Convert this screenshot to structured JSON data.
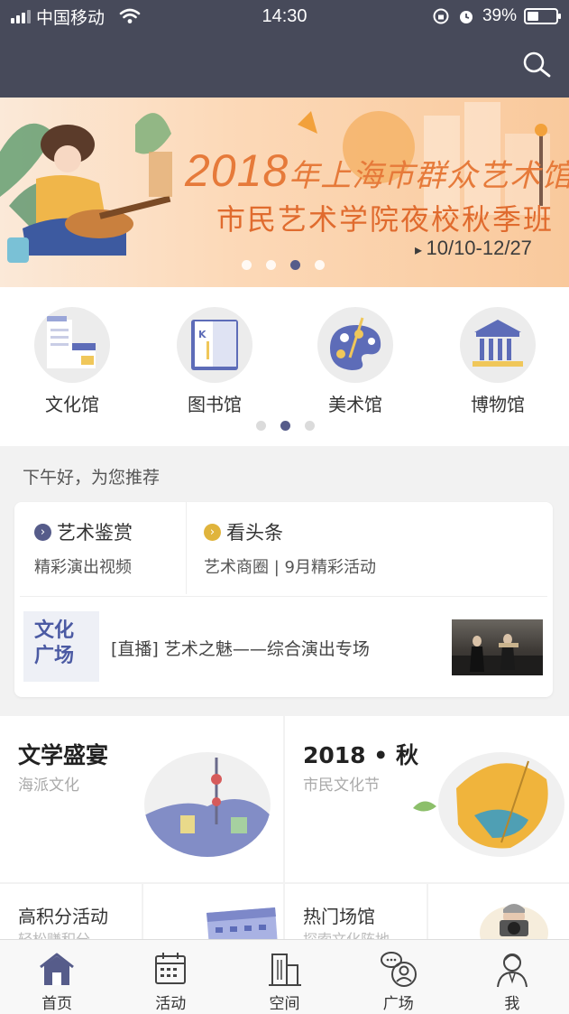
{
  "status_bar": {
    "carrier": "中国移动",
    "time": "14:30",
    "battery": "39%",
    "battery_level": 0.39
  },
  "header": {
    "search_icon": "search-icon"
  },
  "banner": {
    "title_year": "2018",
    "title_rest": "年上海市群众艺术馆",
    "subtitle": "市民艺术学院夜校秋季班",
    "dates": "10/10-12/27",
    "pages": 4,
    "active_page": 3
  },
  "categories": {
    "items": [
      {
        "label": "文化馆",
        "icon": "building-icon"
      },
      {
        "label": "图书馆",
        "icon": "book-icon"
      },
      {
        "label": "美术馆",
        "icon": "palette-icon"
      },
      {
        "label": "博物馆",
        "icon": "museum-icon"
      }
    ],
    "pages": 3,
    "active_page": 2
  },
  "greeting": "下午好，为您推荐",
  "recommend": {
    "left": {
      "title": "艺术鉴赏",
      "subtitle": "精彩演出视频",
      "accent": "#565c8a"
    },
    "right": {
      "title": "看头条",
      "subtitle": "艺术商圈 | 9月精彩活动",
      "accent": "#e0b43c"
    },
    "live": {
      "logo_line1": "文化",
      "logo_line2": "广场",
      "text": "[直播] 艺术之魅——综合演出专场"
    }
  },
  "grid": {
    "big": [
      {
        "title": "文学盛宴",
        "subtitle": "海派文化"
      },
      {
        "title": "2018 • 秋",
        "subtitle": "市民文化节"
      }
    ],
    "small": [
      {
        "title": "高积分活动",
        "subtitle": "轻松赚积分"
      },
      {
        "title": "热门场馆",
        "subtitle": "探索文化阵地"
      }
    ]
  },
  "tabbar": {
    "items": [
      {
        "label": "首页",
        "icon": "home-icon",
        "active": true
      },
      {
        "label": "活动",
        "icon": "calendar-icon",
        "active": false
      },
      {
        "label": "空间",
        "icon": "buildings-icon",
        "active": false
      },
      {
        "label": "广场",
        "icon": "chat-user-icon",
        "active": false
      },
      {
        "label": "我",
        "icon": "person-icon",
        "active": false
      }
    ]
  },
  "colors": {
    "header_bg": "#474a5a",
    "accent": "#565c8a",
    "banner_text": "#e67a3a"
  }
}
